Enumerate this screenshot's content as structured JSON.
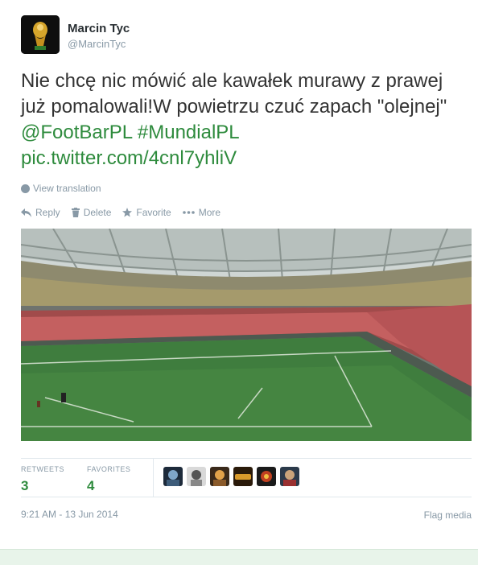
{
  "user": {
    "name": "Marcin Tyc",
    "handle": "@MarcinTyc"
  },
  "tweet": {
    "text_plain": "Nie chcę nic mówić ale kawałek murawy z prawej już pomalowali!W powietrzu czuć zapach \"olejnej\" ",
    "mention": "@FootBarPL",
    "hashtag": "#MundialPL",
    "link": "pic.twitter.com/4cnl7yhliV",
    "translate_label": "View translation"
  },
  "actions": {
    "reply": "Reply",
    "delete": "Delete",
    "favorite": "Favorite",
    "more": "More"
  },
  "stats": {
    "retweets_label": "RETWEETS",
    "retweets_value": "3",
    "favorites_label": "FAVORITES",
    "favorites_value": "4"
  },
  "favoriters": [
    {
      "icon": "avatar-1"
    },
    {
      "icon": "avatar-2"
    },
    {
      "icon": "avatar-3"
    },
    {
      "icon": "avatar-footbar"
    },
    {
      "icon": "avatar-5"
    },
    {
      "icon": "avatar-6"
    }
  ],
  "footer": {
    "timestamp": "9:21 AM - 13 Jun 2014",
    "flag_media": "Flag media"
  },
  "colors": {
    "accent": "#2e8b3d",
    "muted": "#8899a6"
  }
}
